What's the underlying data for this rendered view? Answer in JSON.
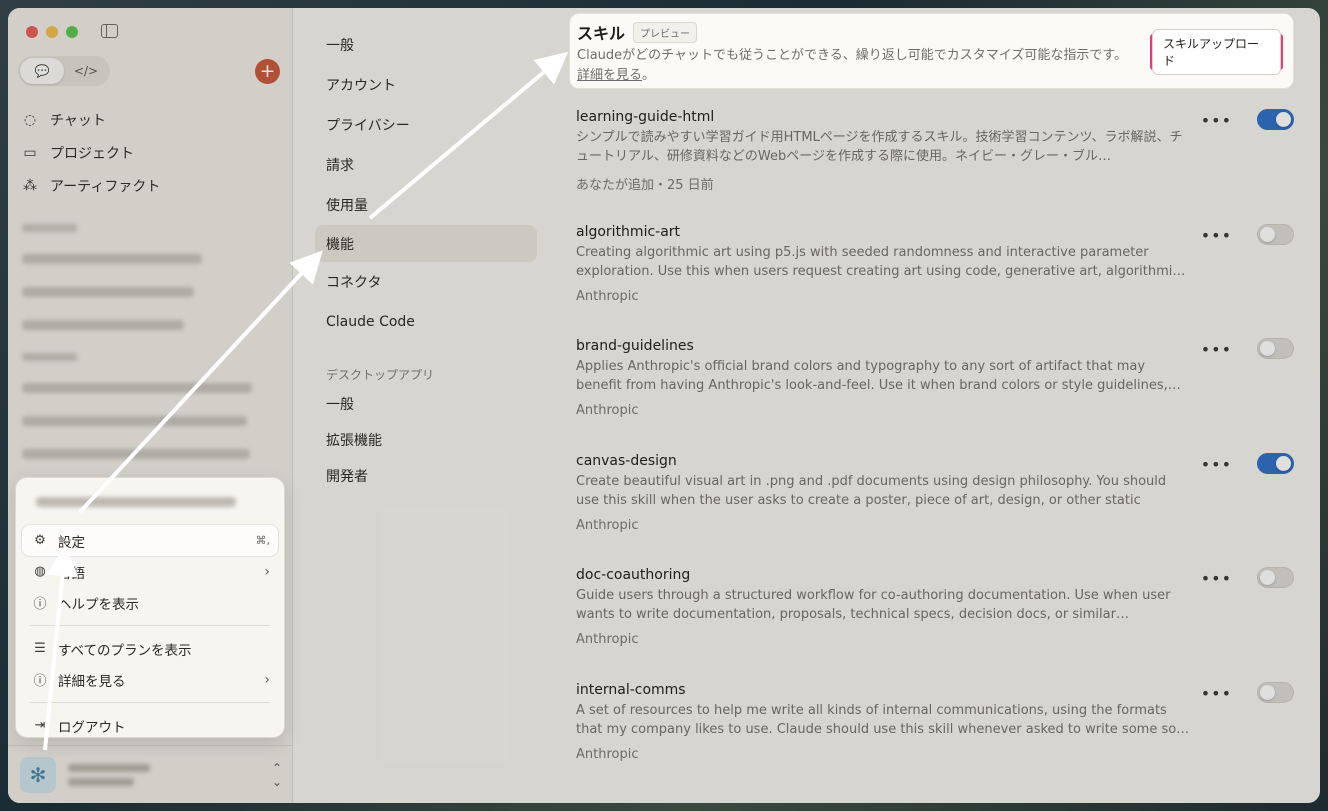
{
  "sidebar": {
    "nav": [
      {
        "label": "チャット",
        "icon": "chat-icon"
      },
      {
        "label": "プロジェクト",
        "icon": "folder-icon"
      },
      {
        "label": "アーティファクト",
        "icon": "artifact-icon"
      }
    ]
  },
  "popup": {
    "items": [
      {
        "label": "設定",
        "shortcut": "⌘,",
        "icon": "gear-icon"
      },
      {
        "label": "言語",
        "icon": "globe-icon"
      },
      {
        "label": "ヘルプを表示",
        "icon": "help-icon"
      },
      {
        "label": "すべてのプランを表示",
        "icon": "plans-icon"
      },
      {
        "label": "詳細を見る",
        "icon": "info-icon"
      },
      {
        "label": "ログアウト",
        "icon": "logout-icon"
      }
    ]
  },
  "settings_nav": {
    "items": [
      "一般",
      "アカウント",
      "プライバシー",
      "請求",
      "使用量",
      "機能",
      "コネクタ",
      "Claude Code"
    ],
    "active_index": 5,
    "section_label": "デスクトップアプリ",
    "sub_items": [
      "一般",
      "拡張機能",
      "開発者"
    ]
  },
  "skills_header": {
    "title": "スキル",
    "badge": "プレビュー",
    "description": "Claudeがどのチャットでも従うことができる、繰り返し可能でカスタマイズ可能な指示です。",
    "link": "詳細を見る",
    "link_suffix": "。",
    "upload_button": "スキルアップロード"
  },
  "skills": [
    {
      "name": "learning-guide-html",
      "description": "シンプルで読みやすい学習ガイド用HTMLページを作成するスキル。技術学習コンテンツ、ラボ解説、チュートリアル、研修資料などのWebページを作成する際に使用。ネイビー・グレー・ブル…",
      "meta": "あなたが追加・25 日前",
      "enabled": true
    },
    {
      "name": "algorithmic-art",
      "description": "Creating algorithmic art using p5.js with seeded randomness and interactive parameter exploration. Use this when users request creating art using code, generative art, algorithmi…",
      "meta": "Anthropic",
      "enabled": false
    },
    {
      "name": "brand-guidelines",
      "description": "Applies Anthropic's official brand colors and typography to any sort of artifact that may benefit from having Anthropic's look-and-feel. Use it when brand colors or style guidelines,…",
      "meta": "Anthropic",
      "enabled": false
    },
    {
      "name": "canvas-design",
      "description": "Create beautiful visual art in .png and .pdf documents using design philosophy. You should use this skill when the user asks to create a poster, piece of art, design, or other static piece…",
      "meta": "Anthropic",
      "enabled": true
    },
    {
      "name": "doc-coauthoring",
      "description": "Guide users through a structured workflow for co-authoring documentation. Use when user wants to write documentation, proposals, technical specs, decision docs, or similar…",
      "meta": "Anthropic",
      "enabled": false
    },
    {
      "name": "internal-comms",
      "description": "A set of resources to help me write all kinds of internal communications, using the formats that my company likes to use. Claude should use this skill whenever asked to write some so…",
      "meta": "Anthropic",
      "enabled": false
    }
  ],
  "colors": {
    "toggle_on": "#2f6fc7",
    "highlight_border": "#e23a7a",
    "new_chat": "#c8593d"
  }
}
